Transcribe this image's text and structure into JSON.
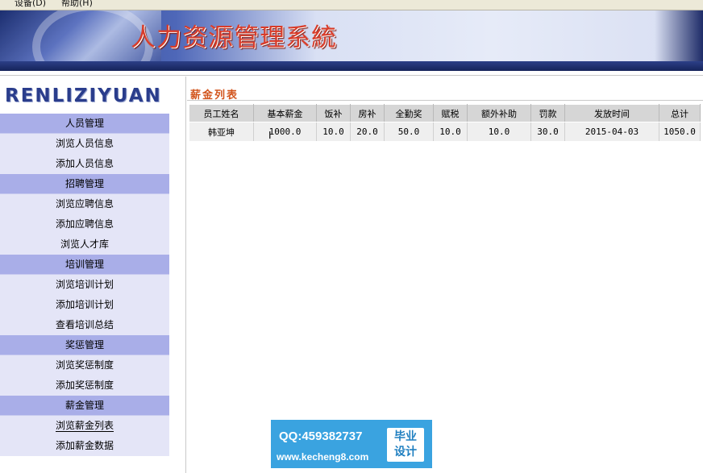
{
  "menubar": {
    "items": [
      "设备(D)",
      "帮助(H)"
    ]
  },
  "banner": {
    "title": "人力资源管理系統"
  },
  "sidebar": {
    "logo": "RENLIZIYUAN",
    "menu": [
      {
        "type": "group",
        "label": "人员管理"
      },
      {
        "type": "item",
        "label": "浏览人员信息"
      },
      {
        "type": "item",
        "label": "添加人员信息"
      },
      {
        "type": "group",
        "label": "招聘管理"
      },
      {
        "type": "item",
        "label": "浏览应聘信息"
      },
      {
        "type": "item",
        "label": "添加应聘信息"
      },
      {
        "type": "item",
        "label": "浏览人才库"
      },
      {
        "type": "group",
        "label": "培训管理"
      },
      {
        "type": "item",
        "label": "浏览培训计划"
      },
      {
        "type": "item",
        "label": "添加培训计划"
      },
      {
        "type": "item",
        "label": "查看培训总结"
      },
      {
        "type": "group",
        "label": "奖惩管理"
      },
      {
        "type": "item",
        "label": "浏览奖惩制度"
      },
      {
        "type": "item",
        "label": "添加奖惩制度"
      },
      {
        "type": "group",
        "label": "薪金管理"
      },
      {
        "type": "item",
        "label": "浏览薪金列表",
        "active": true
      },
      {
        "type": "item",
        "label": "添加薪金数据"
      }
    ]
  },
  "main": {
    "list_title": "薪金列表",
    "table": {
      "headers": [
        "员工姓名",
        "基本薪金",
        "饭补",
        "房补",
        "全勤奖",
        "赋税",
        "额外补助",
        "罚款",
        "发放时间",
        "总计"
      ],
      "rows": [
        [
          "韩亚坤",
          "1000.0",
          "10.0",
          "20.0",
          "50.0",
          "10.0",
          "10.0",
          "30.0",
          "2015-04-03",
          "1050.0"
        ]
      ]
    }
  },
  "watermark": {
    "qq": "QQ:459382737",
    "site": "www.kecheng8.com",
    "badge_line1": "毕业",
    "badge_line2": "设计"
  }
}
